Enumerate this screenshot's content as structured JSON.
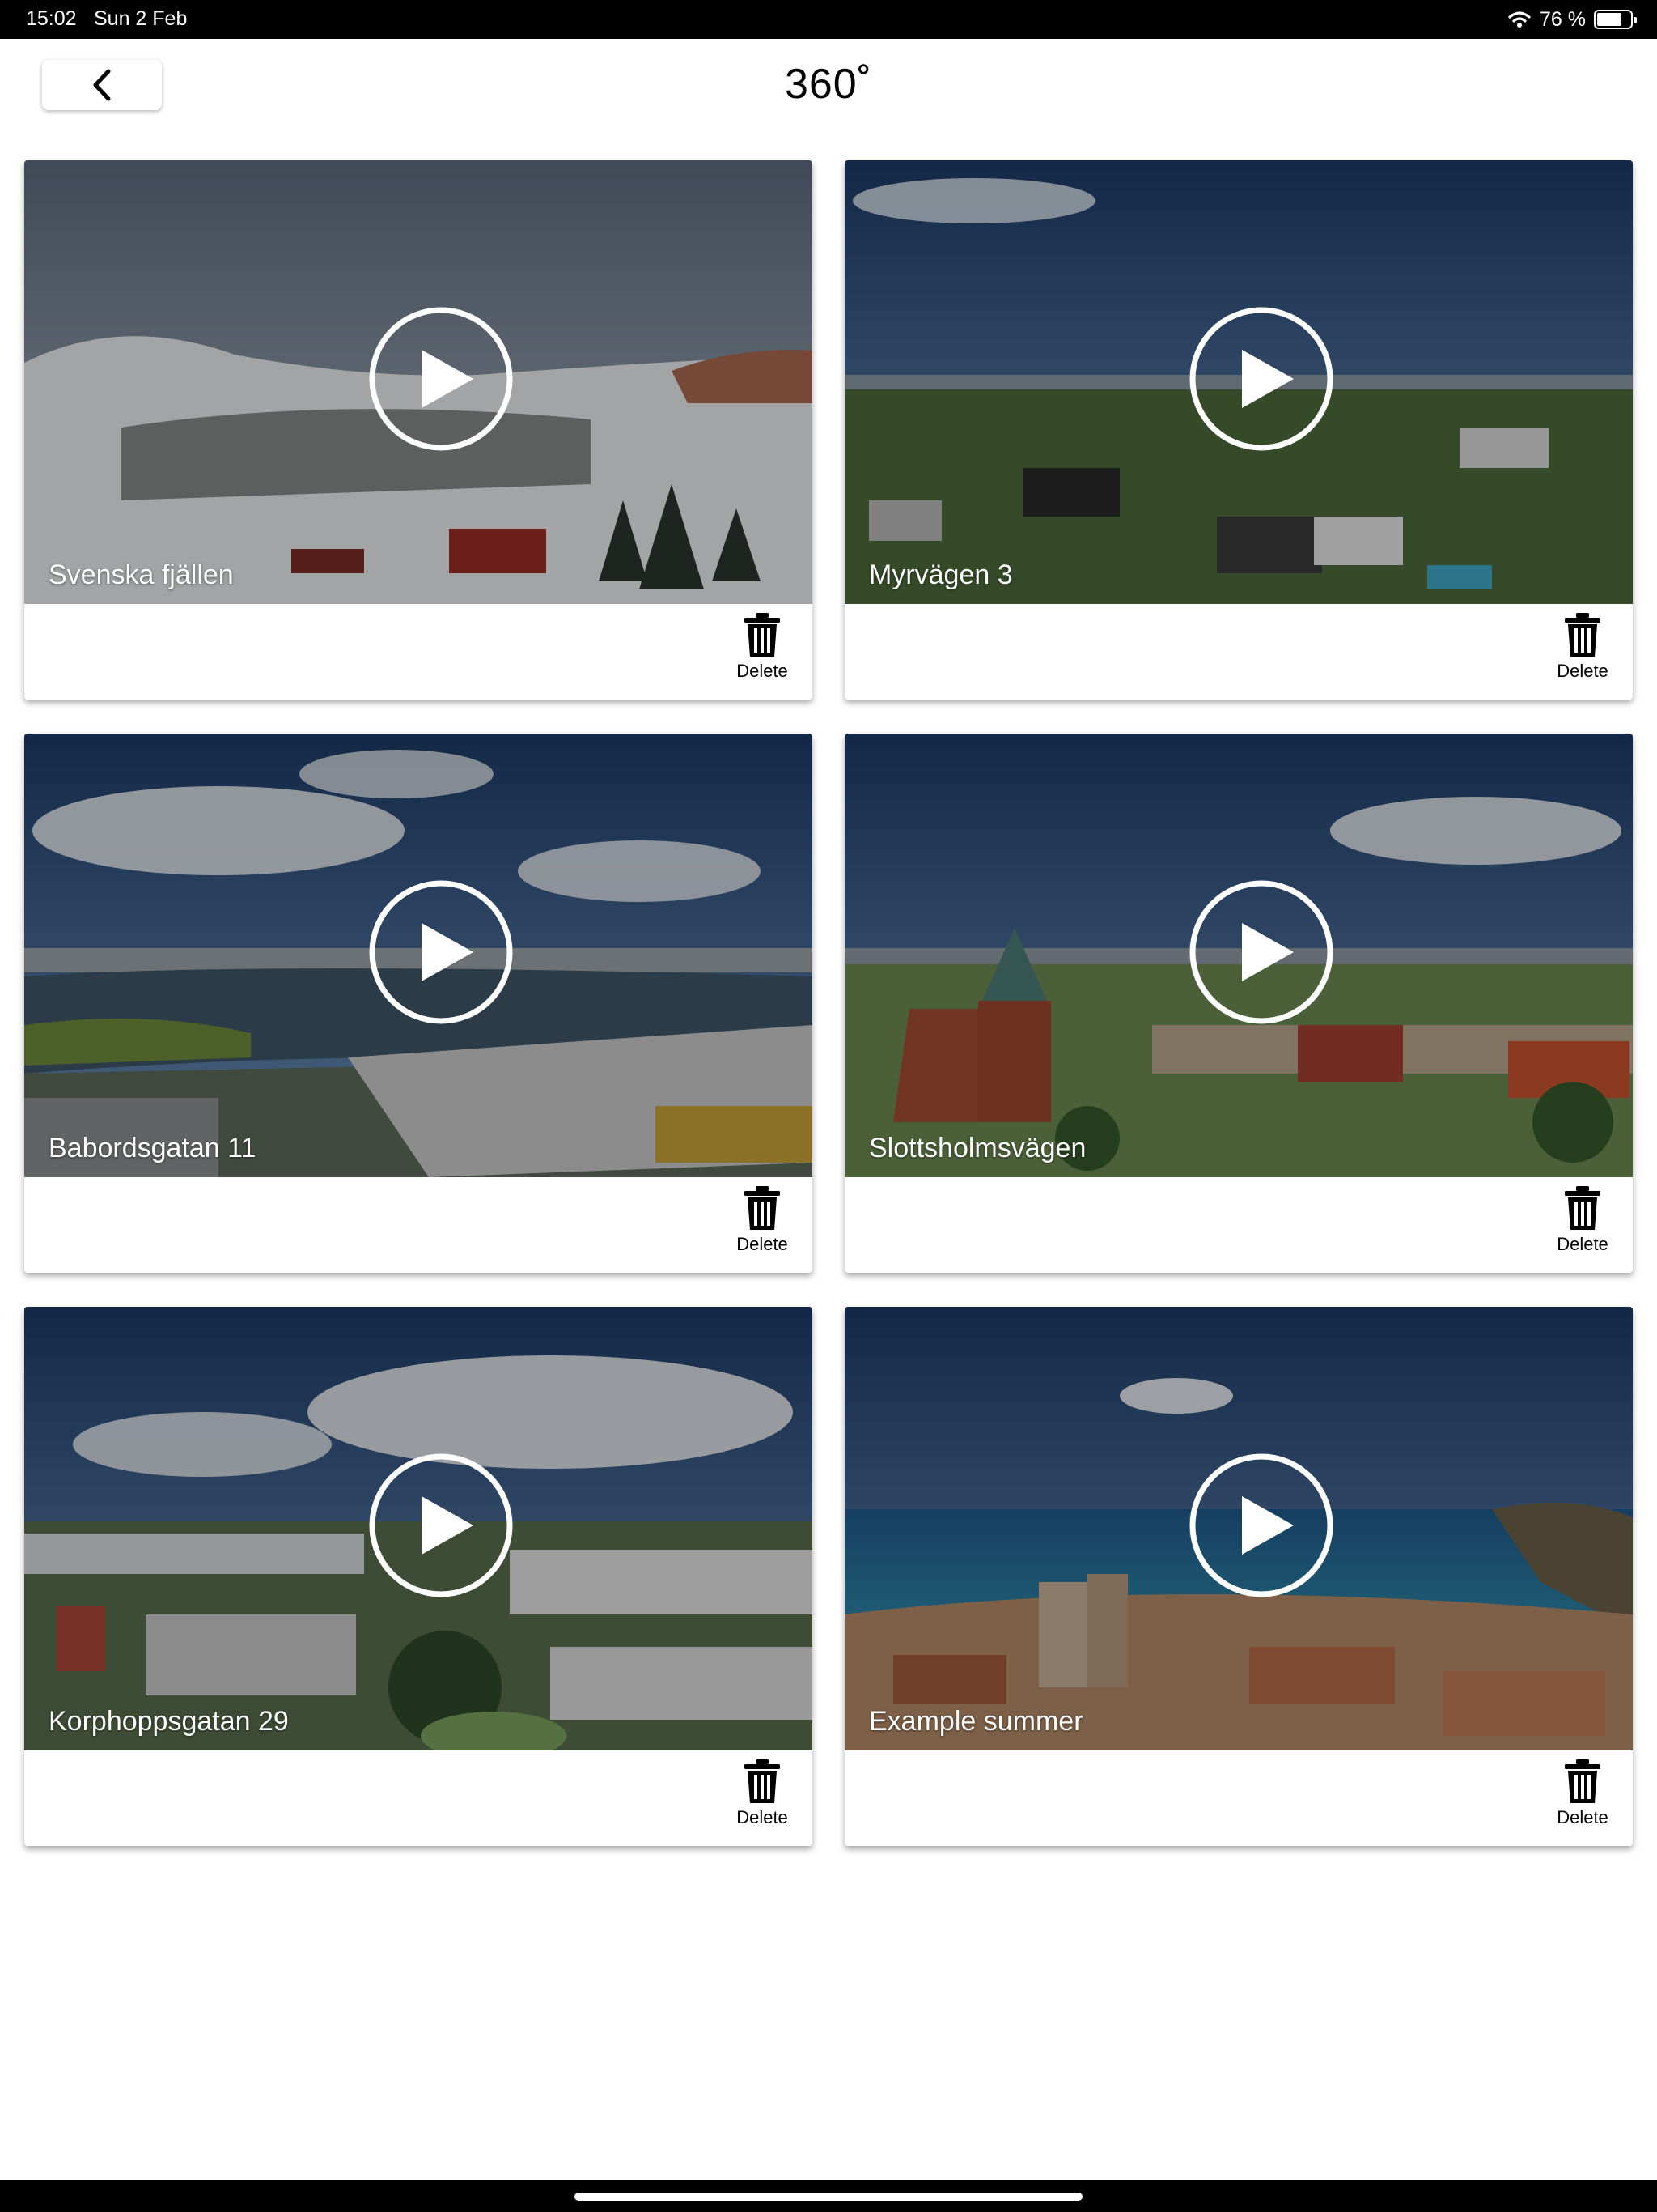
{
  "status_bar": {
    "time": "15:02",
    "date": "Sun 2 Feb",
    "battery": "76 %",
    "battery_level": 0.76
  },
  "header": {
    "title": "360˚",
    "back_icon": "chevron-left-icon"
  },
  "cards": [
    {
      "title": "Svenska fjällen",
      "delete_label": "Delete",
      "scene": "snow"
    },
    {
      "title": "Myrvägen 3",
      "delete_label": "Delete",
      "scene": "suburb"
    },
    {
      "title": "Babordsgatan 11",
      "delete_label": "Delete",
      "scene": "river"
    },
    {
      "title": "Slottsholmsvägen",
      "delete_label": "Delete",
      "scene": "church"
    },
    {
      "title": "Korphoppsgatan 29",
      "delete_label": "Delete",
      "scene": "apartments"
    },
    {
      "title": "Example summer",
      "delete_label": "Delete",
      "scene": "coast"
    }
  ],
  "icons": {
    "play": "play-circle-icon",
    "delete": "trash-icon",
    "wifi": "wifi-icon",
    "battery": "battery-icon"
  }
}
